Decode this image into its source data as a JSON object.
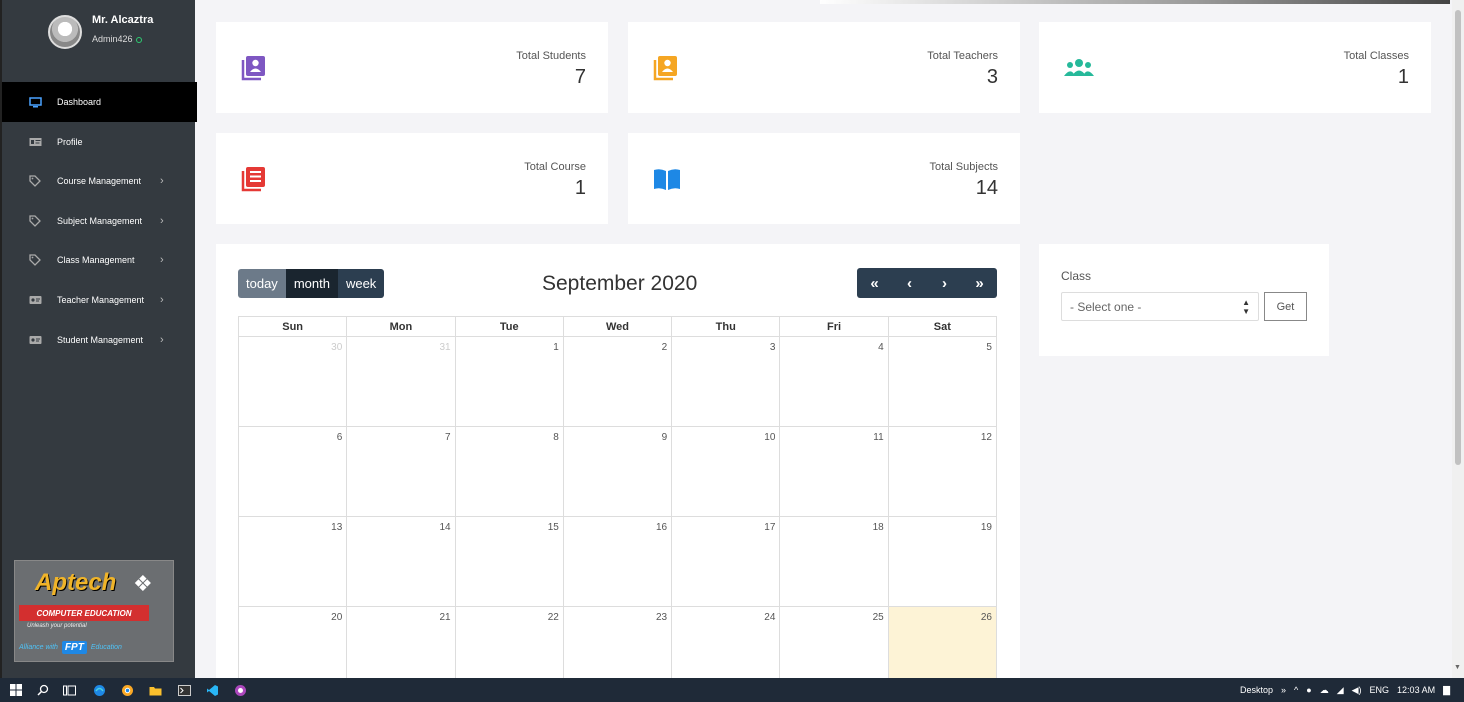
{
  "user": {
    "name": "Mr. Alcaztra",
    "role": "Admin426"
  },
  "sidebar": {
    "items": [
      {
        "label": "Dashboard",
        "icon": "monitor-icon",
        "active": true,
        "has_children": false
      },
      {
        "label": "Profile",
        "icon": "id-card-icon",
        "active": false,
        "has_children": false
      },
      {
        "label": "Course Management",
        "icon": "tag-icon",
        "active": false,
        "has_children": true
      },
      {
        "label": "Subject Management",
        "icon": "tag-icon",
        "active": false,
        "has_children": true
      },
      {
        "label": "Class Management",
        "icon": "tag-icon",
        "active": false,
        "has_children": true
      },
      {
        "label": "Teacher Management",
        "icon": "id-badge-icon",
        "active": false,
        "has_children": true
      },
      {
        "label": "Student Management",
        "icon": "id-badge-icon",
        "active": false,
        "has_children": true
      }
    ],
    "chevron": "›"
  },
  "logo": {
    "brand": "Aptech",
    "line": "COMPUTER EDUCATION",
    "tagline": "Unleash your potential",
    "alliance_prefix": "Alliance with",
    "alliance_badge": "FPT",
    "alliance_suffix": "Education"
  },
  "stats": [
    {
      "label": "Total Students",
      "value": "7",
      "icon": "student-book-icon",
      "color": "#7e57c2"
    },
    {
      "label": "Total Teachers",
      "value": "3",
      "icon": "teacher-badge-icon",
      "color": "#f5a623"
    },
    {
      "label": "Total Classes",
      "value": "1",
      "icon": "users-group-icon",
      "color": "#26b99a"
    },
    {
      "label": "Total Course",
      "value": "1",
      "icon": "course-book-icon",
      "color": "#e53935"
    },
    {
      "label": "Total Subjects",
      "value": "14",
      "icon": "open-book-icon",
      "color": "#1e88e5"
    }
  ],
  "calendar": {
    "buttons": {
      "today": "today",
      "month": "month",
      "week": "week"
    },
    "title": "September 2020",
    "nav": {
      "prev_year": "«",
      "prev": "‹",
      "next": "›",
      "next_year": "»"
    },
    "weekdays": [
      "Sun",
      "Mon",
      "Tue",
      "Wed",
      "Thu",
      "Fri",
      "Sat"
    ],
    "weeks": [
      [
        "30",
        "31",
        "1",
        "2",
        "3",
        "4",
        "5"
      ],
      [
        "6",
        "7",
        "8",
        "9",
        "10",
        "11",
        "12"
      ],
      [
        "13",
        "14",
        "15",
        "16",
        "17",
        "18",
        "19"
      ],
      [
        "20",
        "21",
        "22",
        "23",
        "24",
        "25",
        "26"
      ]
    ],
    "other_month_days": [
      "30",
      "31"
    ],
    "today": "26",
    "today_color": "#fdf3d6"
  },
  "class_filter": {
    "label": "Class",
    "selected": "- Select one -",
    "button": "Get"
  },
  "taskbar": {
    "desktop_label": "Desktop",
    "lang": "ENG",
    "time": "12:03 AM"
  }
}
